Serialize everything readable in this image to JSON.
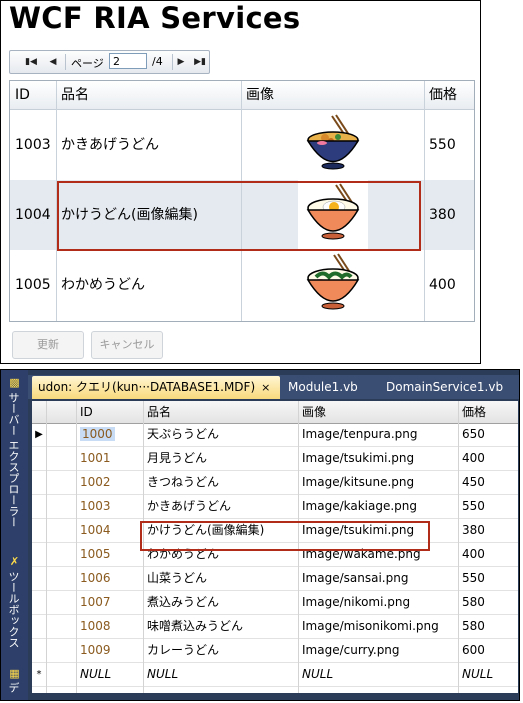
{
  "app": {
    "title": "WCF RIA Services",
    "pager": {
      "first_icon": "first-page-icon",
      "prev_icon": "prev-page-icon",
      "page_label": "ページ",
      "page_value": "2",
      "total": "/4",
      "next_icon": "next-page-icon",
      "last_icon": "last-page-icon"
    },
    "grid": {
      "columns": [
        "ID",
        "品名",
        "画像",
        "価格"
      ],
      "rows": [
        {
          "id": "1003",
          "name": "かきあげうどん",
          "image": "kakiage-udon-bowl",
          "price": "550"
        },
        {
          "id": "1004",
          "name": "かけうどん(画像編集)",
          "image": "tsukimi-udon-bowl",
          "price": "380"
        },
        {
          "id": "1005",
          "name": "わかめうどん",
          "image": "wakame-udon-bowl",
          "price": "400"
        }
      ]
    },
    "buttons": {
      "update": "更新",
      "cancel": "キャンセル"
    }
  },
  "vs": {
    "side_tabs": [
      "サーバー エクスプローラー",
      "ツールボックス",
      "デ"
    ],
    "tabs": [
      {
        "label": "udon: クエリ(kun···DATABASE1.MDF)",
        "close": "×"
      },
      {
        "label": "Module1.vb"
      },
      {
        "label": "DomainService1.vb"
      }
    ],
    "grid": {
      "columns": [
        "ID",
        "品名",
        "画像",
        "価格"
      ],
      "rows": [
        {
          "marker": "▶",
          "id": "1000",
          "name": "天ぷらうどん",
          "image": "Image/tenpura.png",
          "price": "650"
        },
        {
          "marker": "",
          "id": "1001",
          "name": "月見うどん",
          "image": "Image/tsukimi.png",
          "price": "400"
        },
        {
          "marker": "",
          "id": "1002",
          "name": "きつねうどん",
          "image": "Image/kitsune.png",
          "price": "450"
        },
        {
          "marker": "",
          "id": "1003",
          "name": "かきあげうどん",
          "image": "Image/kakiage.png",
          "price": "550"
        },
        {
          "marker": "",
          "id": "1004",
          "name": "かけうどん(画像編集)",
          "image": "Image/tsukimi.png",
          "price": "380"
        },
        {
          "marker": "",
          "id": "1005",
          "name": "わかめうどん",
          "image": "Image/wakame.png",
          "price": "400"
        },
        {
          "marker": "",
          "id": "1006",
          "name": "山菜うどん",
          "image": "Image/sansai.png",
          "price": "550"
        },
        {
          "marker": "",
          "id": "1007",
          "name": "煮込みうどん",
          "image": "Image/nikomi.png",
          "price": "580"
        },
        {
          "marker": "",
          "id": "1008",
          "name": "味噌煮込みうどん",
          "image": "Image/misonikomi.png",
          "price": "580"
        },
        {
          "marker": "",
          "id": "1009",
          "name": "カレーうどん",
          "image": "Image/curry.png",
          "price": "600"
        },
        {
          "marker": "*",
          "id": "NULL",
          "name": "NULL",
          "image": "NULL",
          "price": "NULL"
        }
      ]
    }
  },
  "colors": {
    "highlight_border": "#b22c1a",
    "vs_background": "#2b3c59",
    "active_tab": "#f8d97c",
    "id_text": "#8a5a1e"
  }
}
